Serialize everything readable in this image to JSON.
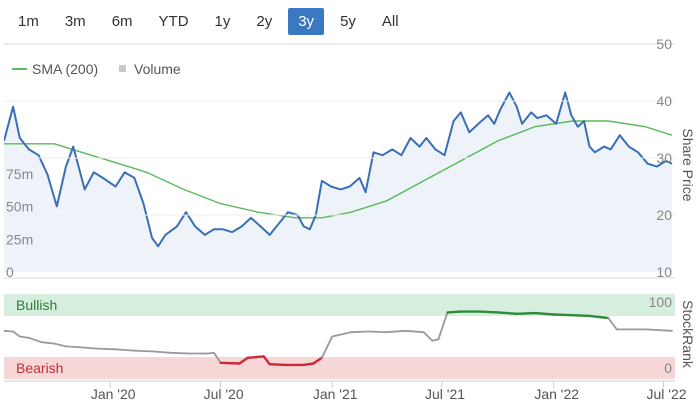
{
  "range_selector": {
    "buttons": [
      "1m",
      "3m",
      "6m",
      "YTD",
      "1y",
      "2y",
      "3y",
      "5y",
      "All"
    ],
    "active": "3y"
  },
  "legend": {
    "sma_label": "SMA (200)",
    "volume_label": "Volume"
  },
  "colors": {
    "price_line": "#3a6fb6",
    "price_fill": "#eef3fa",
    "sma_line": "#5cb85c",
    "volume_bar": "#c8c8c8",
    "bullish_band": "#d6eedd",
    "bearish_band": "#f6d6d6",
    "rank_neutral": "#9a9a9a",
    "rank_bullish": "#2e8b3a",
    "rank_bearish": "#cc2a36",
    "active_button": "#3a78c2"
  },
  "chart_data": [
    {
      "type": "line",
      "ylabel": "Share Price",
      "ylim": [
        10,
        50
      ],
      "y_ticks": [
        "50",
        "40",
        "30",
        "20",
        "10"
      ],
      "volume_ticks": [
        "75m",
        "50m",
        "25m",
        "0"
      ],
      "x_ticks": [
        "Jan '20",
        "Jul '20",
        "Jan '21",
        "Jul '21",
        "Jan '22",
        "Jul '22"
      ],
      "series": [
        {
          "name": "Share Price",
          "points": [
            [
              "2019-07-10",
              33.0
            ],
            [
              "2019-07-25",
              39.0
            ],
            [
              "2019-08-05",
              33.5
            ],
            [
              "2019-08-20",
              31.5
            ],
            [
              "2019-09-05",
              30.5
            ],
            [
              "2019-09-20",
              27.0
            ],
            [
              "2019-10-05",
              21.5
            ],
            [
              "2019-10-20",
              28.5
            ],
            [
              "2019-11-01",
              32.0
            ],
            [
              "2019-11-10",
              28.5
            ],
            [
              "2019-11-20",
              24.5
            ],
            [
              "2019-12-05",
              27.5
            ],
            [
              "2019-12-20",
              26.5
            ],
            [
              "2020-01-10",
              25.0
            ],
            [
              "2020-01-25",
              27.5
            ],
            [
              "2020-02-10",
              26.5
            ],
            [
              "2020-02-25",
              22.0
            ],
            [
              "2020-03-10",
              16.0
            ],
            [
              "2020-03-20",
              14.5
            ],
            [
              "2020-04-01",
              16.5
            ],
            [
              "2020-04-20",
              18.0
            ],
            [
              "2020-05-05",
              20.5
            ],
            [
              "2020-05-20",
              18.0
            ],
            [
              "2020-06-05",
              16.5
            ],
            [
              "2020-06-20",
              17.5
            ],
            [
              "2020-07-05",
              17.5
            ],
            [
              "2020-07-20",
              17.0
            ],
            [
              "2020-08-05",
              18.0
            ],
            [
              "2020-08-20",
              19.5
            ],
            [
              "2020-09-05",
              18.0
            ],
            [
              "2020-09-20",
              16.5
            ],
            [
              "2020-10-05",
              18.5
            ],
            [
              "2020-10-20",
              20.5
            ],
            [
              "2020-11-05",
              20.0
            ],
            [
              "2020-11-15",
              18.0
            ],
            [
              "2020-11-25",
              17.5
            ],
            [
              "2020-12-05",
              20.0
            ],
            [
              "2020-12-15",
              26.0
            ],
            [
              "2020-12-30",
              25.0
            ],
            [
              "2021-01-15",
              24.5
            ],
            [
              "2021-01-30",
              25.0
            ],
            [
              "2021-02-15",
              26.5
            ],
            [
              "2021-02-25",
              24.0
            ],
            [
              "2021-03-10",
              31.0
            ],
            [
              "2021-03-25",
              30.5
            ],
            [
              "2021-04-10",
              31.5
            ],
            [
              "2021-04-25",
              30.5
            ],
            [
              "2021-05-10",
              33.5
            ],
            [
              "2021-05-25",
              32.0
            ],
            [
              "2021-06-05",
              33.5
            ],
            [
              "2021-06-20",
              31.5
            ],
            [
              "2021-07-05",
              30.5
            ],
            [
              "2021-07-20",
              36.5
            ],
            [
              "2021-08-01",
              38.0
            ],
            [
              "2021-08-15",
              34.5
            ],
            [
              "2021-08-30",
              36.0
            ],
            [
              "2021-09-15",
              37.5
            ],
            [
              "2021-09-25",
              36.0
            ],
            [
              "2021-10-05",
              38.5
            ],
            [
              "2021-10-20",
              41.5
            ],
            [
              "2021-11-01",
              39.0
            ],
            [
              "2021-11-10",
              36.0
            ],
            [
              "2021-11-25",
              38.0
            ],
            [
              "2021-12-05",
              37.0
            ],
            [
              "2021-12-20",
              37.5
            ],
            [
              "2022-01-05",
              36.0
            ],
            [
              "2022-01-20",
              41.5
            ],
            [
              "2022-01-30",
              37.5
            ],
            [
              "2022-02-10",
              35.5
            ],
            [
              "2022-02-20",
              36.5
            ],
            [
              "2022-03-01",
              32.0
            ],
            [
              "2022-03-10",
              31.0
            ],
            [
              "2022-03-25",
              32.0
            ],
            [
              "2022-04-05",
              31.5
            ],
            [
              "2022-04-20",
              34.0
            ],
            [
              "2022-05-05",
              32.0
            ],
            [
              "2022-05-20",
              31.0
            ],
            [
              "2022-06-05",
              29.0
            ],
            [
              "2022-06-20",
              28.5
            ],
            [
              "2022-07-05",
              29.5
            ],
            [
              "2022-07-15",
              29.0
            ]
          ]
        },
        {
          "name": "SMA (200)",
          "points": [
            [
              "2019-07-10",
              32.5
            ],
            [
              "2019-10-01",
              32.5
            ],
            [
              "2019-11-15",
              31.0
            ],
            [
              "2020-01-01",
              29.5
            ],
            [
              "2020-03-01",
              27.5
            ],
            [
              "2020-05-01",
              24.5
            ],
            [
              "2020-07-01",
              22.0
            ],
            [
              "2020-09-01",
              20.5
            ],
            [
              "2020-11-01",
              19.5
            ],
            [
              "2020-12-15",
              19.5
            ],
            [
              "2021-02-01",
              20.5
            ],
            [
              "2021-04-01",
              22.5
            ],
            [
              "2021-06-01",
              26.0
            ],
            [
              "2021-08-01",
              29.5
            ],
            [
              "2021-10-01",
              33.0
            ],
            [
              "2021-12-01",
              35.5
            ],
            [
              "2022-02-01",
              36.5
            ],
            [
              "2022-04-01",
              36.5
            ],
            [
              "2022-06-01",
              35.5
            ],
            [
              "2022-07-15",
              34.0
            ]
          ]
        },
        {
          "name": "Volume",
          "points": [
            [
              "2019-08-10",
              4
            ],
            [
              "2019-09-05",
              3
            ],
            [
              "2019-10-01",
              12
            ],
            [
              "2019-10-20",
              55
            ],
            [
              "2019-11-10",
              3
            ],
            [
              "2019-12-01",
              8
            ],
            [
              "2020-01-05",
              4
            ],
            [
              "2020-01-20",
              40
            ],
            [
              "2020-02-10",
              3
            ],
            [
              "2020-03-01",
              5
            ],
            [
              "2020-03-15",
              10
            ],
            [
              "2020-04-10",
              4
            ],
            [
              "2020-06-01",
              3
            ],
            [
              "2020-09-10",
              4
            ],
            [
              "2020-10-20",
              12
            ],
            [
              "2021-02-20",
              3
            ],
            [
              "2021-07-10",
              6
            ],
            [
              "2021-11-05",
              3
            ],
            [
              "2022-01-10",
              10
            ],
            [
              "2022-03-01",
              3
            ],
            [
              "2022-06-01",
              5
            ]
          ]
        }
      ]
    },
    {
      "type": "line",
      "ylabel": "StockRank",
      "ylim": [
        0,
        100
      ],
      "y_ticks": [
        "100",
        "0"
      ],
      "bands": [
        "Bullish",
        "Bearish"
      ],
      "series": [
        {
          "name": "StockRank",
          "points": [
            [
              "2019-07-10",
              58
            ],
            [
              "2019-07-25",
              57
            ],
            [
              "2019-08-05",
              50
            ],
            [
              "2019-08-20",
              48
            ],
            [
              "2019-09-10",
              42
            ],
            [
              "2019-10-01",
              40
            ],
            [
              "2019-10-20",
              36
            ],
            [
              "2019-11-10",
              35
            ],
            [
              "2019-12-10",
              33
            ],
            [
              "2020-01-10",
              32
            ],
            [
              "2020-02-10",
              30
            ],
            [
              "2020-03-10",
              29
            ],
            [
              "2020-04-10",
              27
            ],
            [
              "2020-05-10",
              26
            ],
            [
              "2020-06-10",
              26
            ],
            [
              "2020-06-20",
              27
            ],
            [
              "2020-07-01",
              13
            ],
            [
              "2020-08-01",
              12
            ],
            [
              "2020-08-15",
              20
            ],
            [
              "2020-09-10",
              22
            ],
            [
              "2020-09-20",
              11
            ],
            [
              "2020-10-15",
              10
            ],
            [
              "2020-11-15",
              10
            ],
            [
              "2020-12-01",
              12
            ],
            [
              "2020-12-15",
              20
            ],
            [
              "2021-01-01",
              50
            ],
            [
              "2021-02-01",
              56
            ],
            [
              "2021-03-01",
              57
            ],
            [
              "2021-04-01",
              56
            ],
            [
              "2021-05-01",
              58
            ],
            [
              "2021-06-01",
              56
            ],
            [
              "2021-06-15",
              44
            ],
            [
              "2021-06-25",
              46
            ],
            [
              "2021-07-10",
              84
            ],
            [
              "2021-08-01",
              85
            ],
            [
              "2021-09-01",
              85
            ],
            [
              "2021-10-01",
              84
            ],
            [
              "2021-11-01",
              82
            ],
            [
              "2021-12-01",
              83
            ],
            [
              "2022-01-01",
              81
            ],
            [
              "2022-02-01",
              80
            ],
            [
              "2022-03-01",
              79
            ],
            [
              "2022-04-01",
              76
            ],
            [
              "2022-04-15",
              60
            ],
            [
              "2022-05-01",
              60
            ],
            [
              "2022-06-01",
              60
            ],
            [
              "2022-07-15",
              58
            ]
          ]
        }
      ]
    }
  ]
}
